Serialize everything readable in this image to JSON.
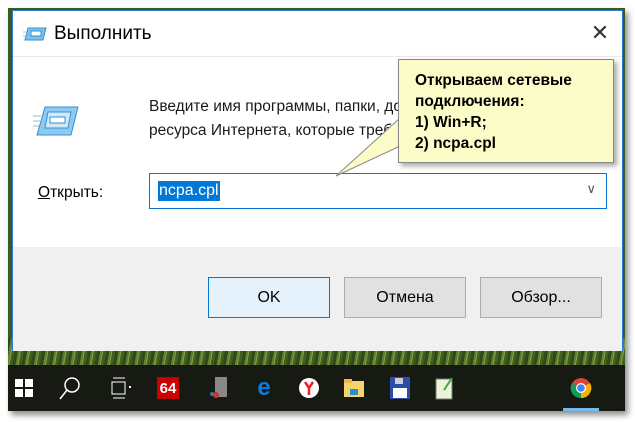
{
  "dialog": {
    "title": "Выполнить",
    "description_line1": "Введите имя программы, папки, документа или",
    "description_line2": "ресурса Интернета, которые требуется открыть.",
    "open_label_accel": "О",
    "open_label_rest": "ткрыть:",
    "input_value": "ncpa.cpl",
    "buttons": {
      "ok": "OK",
      "cancel": "Отмена",
      "browse": "Обзор..."
    }
  },
  "callout": {
    "lines": [
      "Открываем сетевые",
      "подключения:",
      "1) Win+R;",
      "2) ncpa.cpl"
    ],
    "background": "#fcfcc8"
  },
  "taskbar": {
    "icons": [
      "windows-start-icon",
      "search-icon",
      "task-view-icon",
      "aida64-icon",
      "server-app-icon",
      "edge-icon",
      "yandex-browser-icon",
      "file-explorer-icon",
      "floppy-disk-app-icon",
      "notepad-app-icon",
      "chrome-icon"
    ],
    "aida_label": "64"
  },
  "colors": {
    "accent": "#0078d7",
    "taskbar": "#161a12"
  }
}
